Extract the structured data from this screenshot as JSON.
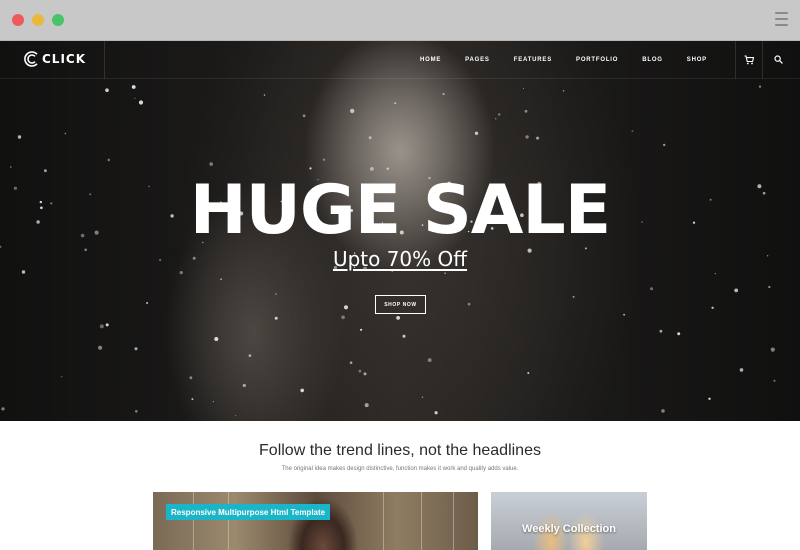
{
  "window": {
    "controls": [
      "close",
      "minimize",
      "maximize"
    ],
    "menu_icon": "hamburger-icon"
  },
  "site": {
    "logo_text": "CLICK",
    "logo_icon": "c-logo-icon",
    "nav": {
      "items": [
        "HOME",
        "PAGES",
        "FEATURES",
        "PORTFOLIO",
        "BLOG",
        "SHOP"
      ],
      "cart_icon": "cart-icon",
      "search_icon": "search-icon"
    }
  },
  "hero": {
    "title": "HUGE SALE",
    "subtitle": "Upto 70% Off",
    "button_label": "SHOP NOW"
  },
  "section": {
    "title": "Follow the trend lines, not the headlines",
    "subtitle": "The original idea makes design distinctive, function makes it work and quality adds value."
  },
  "cards": [
    {
      "tag": "Responsive Multipurpose Html Template"
    },
    {
      "title": "Weekly Collection"
    }
  ],
  "colors": {
    "accent": "#1bb5c9",
    "chrome": "#c8c8c8",
    "hero_bg": "#1c1b1a"
  }
}
